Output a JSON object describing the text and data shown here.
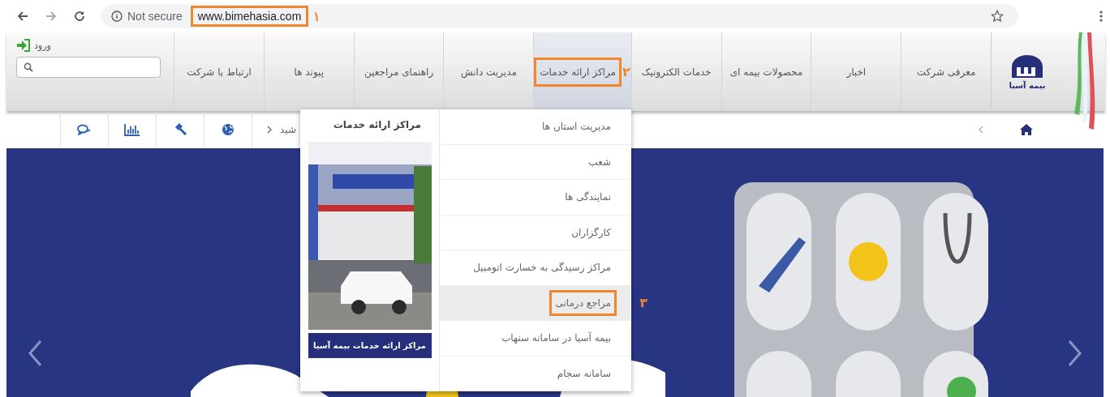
{
  "browser": {
    "security": "Not secure",
    "url": "www.bimehasia.com",
    "url_callout": "١"
  },
  "site": {
    "logo_text": "بیمه آسیا",
    "login": "ورود"
  },
  "nav": [
    {
      "label": "معرفی شرکت",
      "selected": false
    },
    {
      "label": "اخبار",
      "selected": false
    },
    {
      "label": "محصولات بیمه ای",
      "selected": false
    },
    {
      "label": "خدمات الکترونیک",
      "selected": false
    },
    {
      "label": "مراکز ارائه خدمات",
      "selected": true,
      "callout": "۲"
    },
    {
      "label": "مدیریت دانش",
      "selected": false
    },
    {
      "label": "راهنمای مراجعین",
      "selected": false
    },
    {
      "label": "پیوند ها",
      "selected": false
    },
    {
      "label": "ارتباط با شرکت",
      "selected": false
    }
  ],
  "breadcrumb": {
    "text": "شید"
  },
  "dropdown": {
    "title": "مراکز ارائه خدمات",
    "caption": "مراکز ارائه خدمات بیمه آسیا",
    "items": [
      {
        "label": "مدیریت استان ها",
        "selected": false
      },
      {
        "label": "شعب",
        "selected": false
      },
      {
        "label": "نمایندگی ها",
        "selected": false
      },
      {
        "label": "کارگزاران",
        "selected": false
      },
      {
        "label": "مراکز رسیدگی به خسارت اتومبیل",
        "selected": false
      },
      {
        "label": "مراجع درمانی",
        "selected": true,
        "callout": "۳"
      },
      {
        "label": "بیمه آسیا در سامانه سنهاب",
        "selected": false
      },
      {
        "label": "سامانه سجام",
        "selected": false
      }
    ]
  }
}
